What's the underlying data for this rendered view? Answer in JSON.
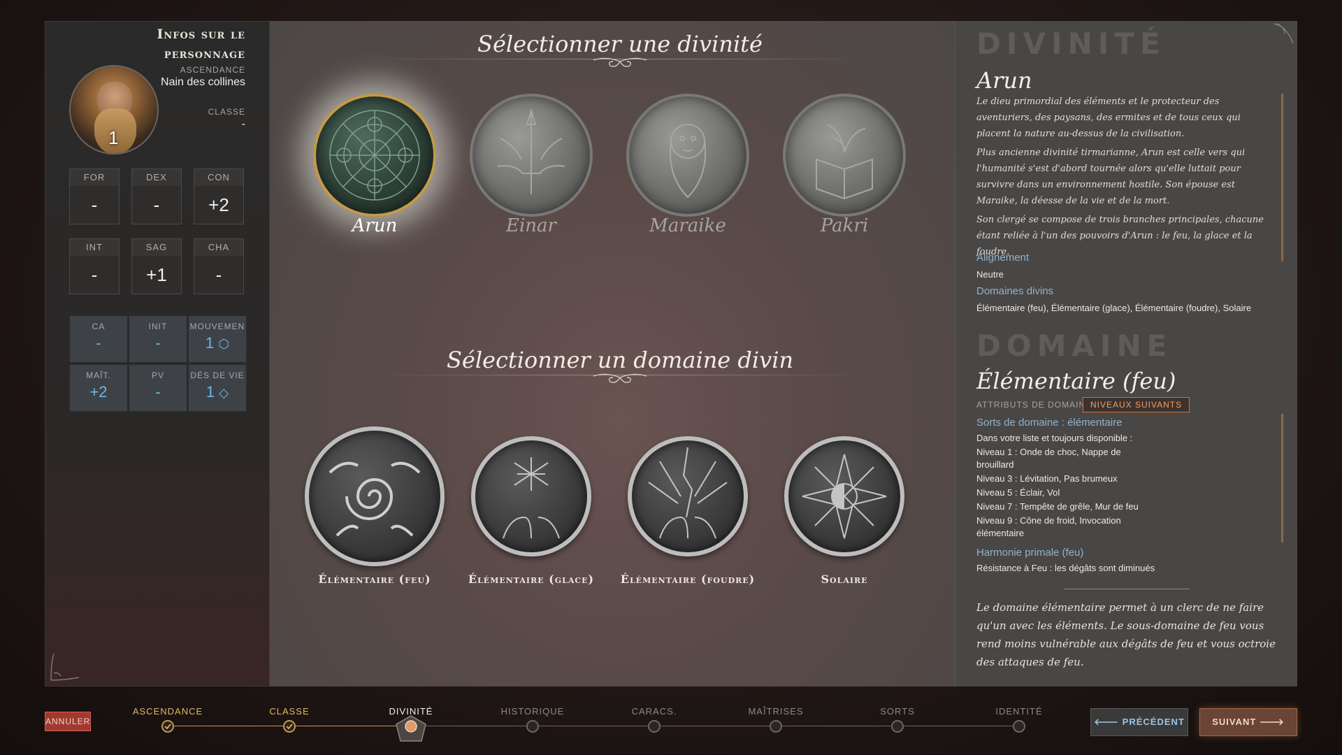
{
  "left": {
    "title": "Infos sur le personnage",
    "ancestry_label": "ASCENDANCE",
    "ancestry_value": "Nain des collines",
    "class_label": "CLASSE",
    "class_value": "-",
    "level": "1",
    "stats": [
      {
        "label": "FOR",
        "value": "-"
      },
      {
        "label": "DEX",
        "value": "-"
      },
      {
        "label": "CON",
        "value": "+2"
      },
      {
        "label": "INT",
        "value": "-"
      },
      {
        "label": "SAG",
        "value": "+1"
      },
      {
        "label": "CHA",
        "value": "-"
      }
    ],
    "secondary": [
      {
        "label": "CA",
        "value": "-"
      },
      {
        "label": "INIT",
        "value": "-"
      },
      {
        "label": "MOUVEMEN",
        "value": "1"
      },
      {
        "label": "MAÎT.",
        "value": "+2"
      },
      {
        "label": "PV",
        "value": "-"
      },
      {
        "label": "DÉS DE VIE",
        "value": "1"
      }
    ]
  },
  "center": {
    "deity_title": "Sélectionner une divinité",
    "domain_title": "Sélectionner un domaine divin",
    "deities": [
      {
        "name": "Arun",
        "selected": true
      },
      {
        "name": "Einar",
        "selected": false
      },
      {
        "name": "Maraike",
        "selected": false
      },
      {
        "name": "Pakri",
        "selected": false
      }
    ],
    "domains": [
      {
        "name": "Élémentaire (feu)",
        "selected": true
      },
      {
        "name": "Élémentaire (glace)",
        "selected": false
      },
      {
        "name": "Élémentaire (foudre)",
        "selected": false
      },
      {
        "name": "Solaire",
        "selected": false
      }
    ]
  },
  "right": {
    "deity_header": "DIVINITÉ",
    "deity_name": "Arun",
    "deity_desc": [
      "Le dieu primordial des éléments et le protecteur des aventuriers, des paysans, des ermites et de tous ceux qui placent la nature au-dessus de la civilisation.",
      "Plus ancienne divinité tirmarianne, Arun est celle vers qui l'humanité s'est d'abord tournée alors qu'elle luttait pour survivre dans un environnement hostile. Son épouse est Maraike, la déesse de la vie et de la mort.",
      "Son clergé se compose de trois branches principales, chacune étant reliée à l'un des pouvoirs d'Arun : le feu, la glace et la foudre."
    ],
    "alignment_label": "Alignement",
    "alignment_value": "Neutre",
    "domains_label": "Domaines divins",
    "domains_value": "Élémentaire (feu), Élémentaire (glace), Élémentaire (foudre), Solaire",
    "domain_header": "DOMAINE",
    "domain_name": "Élémentaire (feu)",
    "attributes_label": "ATTRIBUTS DE DOMAIN",
    "next_levels": "NIVEAUX SUIVANTS",
    "spells_label": "Sorts de domaine : élémentaire",
    "spells": [
      "Dans votre liste et toujours disponible :",
      "Niveau 1 : Onde de choc, Nappe de brouillard",
      "Niveau 3 : Lévitation, Pas brumeux",
      "Niveau 5 : Éclair, Vol",
      "Niveau 7 : Tempête de grêle, Mur de feu",
      "Niveau 9 : Cône de froid, Invocation élémentaire"
    ],
    "harmony_label": "Harmonie primale (feu)",
    "harmony_text": "Résistance à Feu : les dégâts sont diminués",
    "quote": "Le domaine élémentaire permet à un clerc de ne faire qu'un avec les éléments. Le sous-domaine de feu vous rend moins vulnérable aux dégâts de feu et vous octroie des attaques de feu."
  },
  "bottom": {
    "cancel": "ANNULER",
    "steps": [
      {
        "label": "ASCENDANCE",
        "state": "done"
      },
      {
        "label": "CLASSE",
        "state": "done"
      },
      {
        "label": "DIVINITÉ",
        "state": "current"
      },
      {
        "label": "HISTORIQUE",
        "state": "todo"
      },
      {
        "label": "CARACS.",
        "state": "todo"
      },
      {
        "label": "MAÎTRISES",
        "state": "todo"
      },
      {
        "label": "SORTS",
        "state": "todo"
      },
      {
        "label": "IDENTITÉ",
        "state": "todo"
      }
    ],
    "prev": "PRÉCÉDENT",
    "next": "SUIVANT"
  },
  "colors": {
    "accent_blue": "#69b8e8",
    "accent_orange": "#d4722e",
    "gold": "#c49a4a"
  }
}
